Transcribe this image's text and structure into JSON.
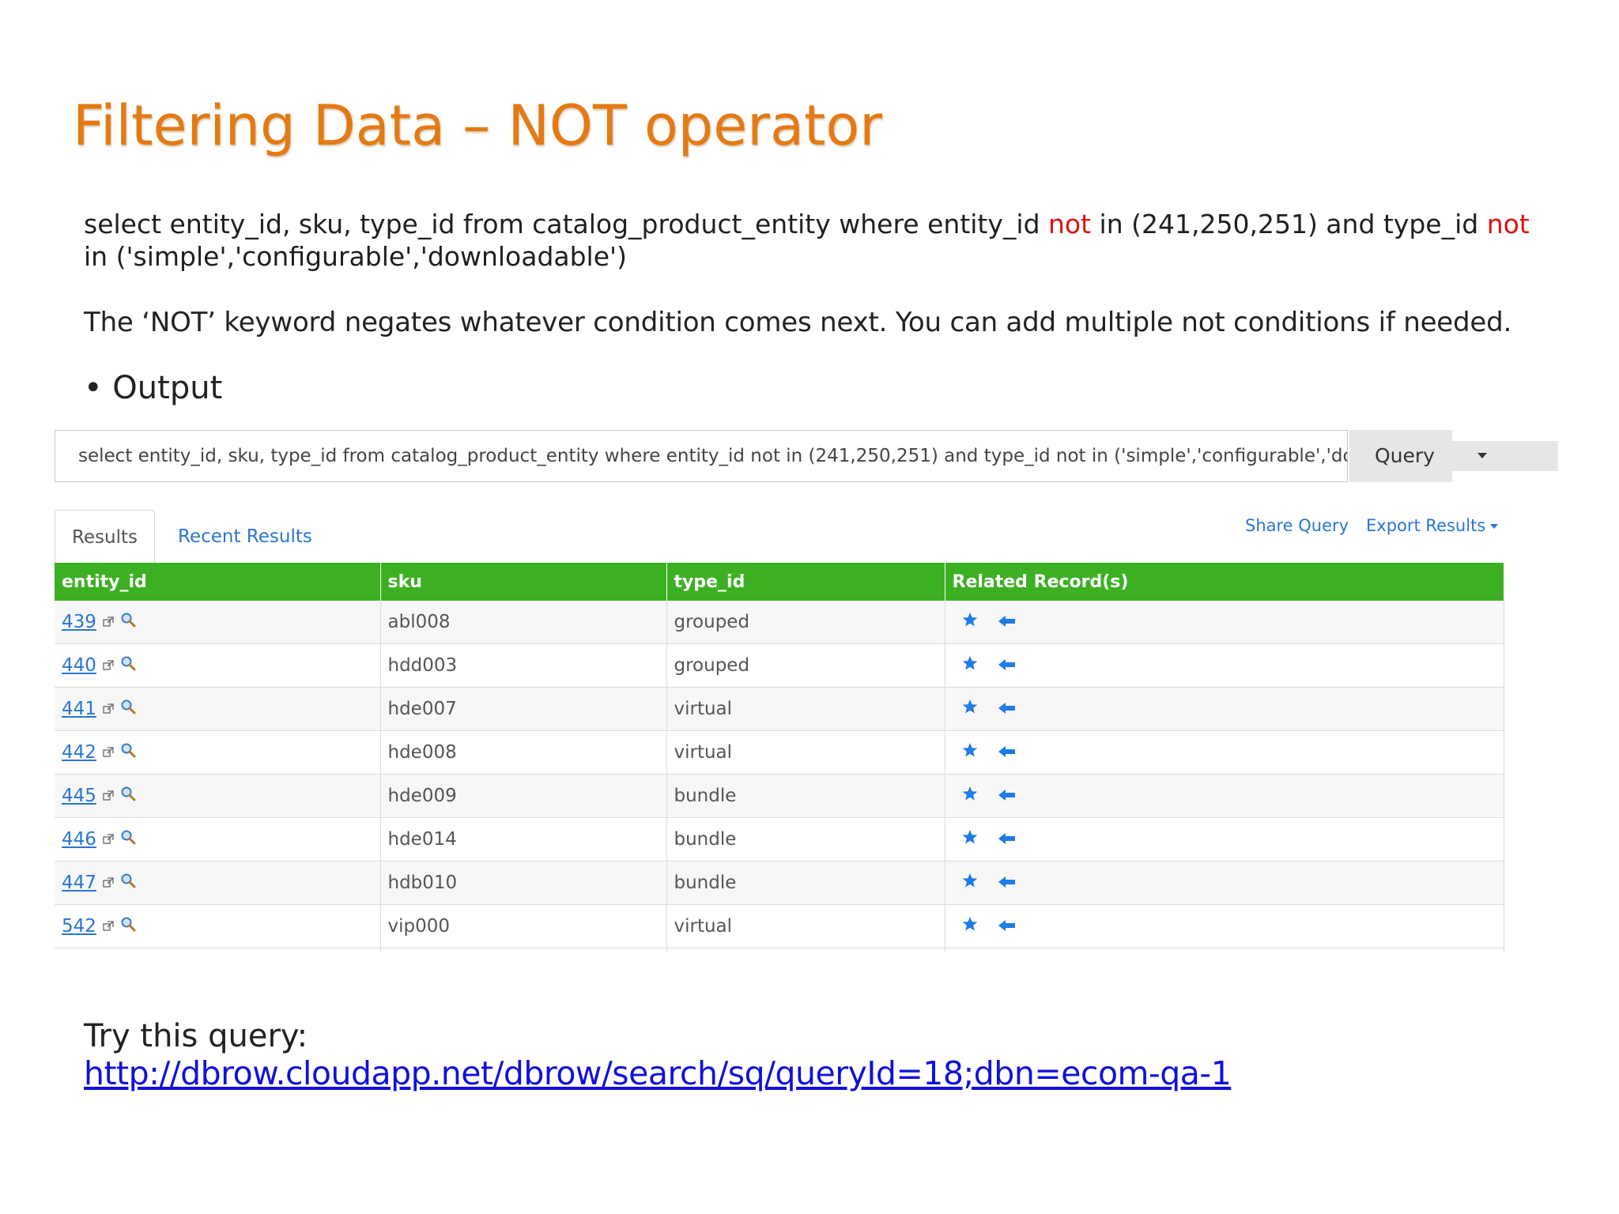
{
  "slide": {
    "title": "Filtering Data – NOT operator",
    "sql": {
      "part1": "select entity_id, sku, type_id from catalog_product_entity where entity_id ",
      "not1": "not",
      "part2": " in (241,250,251) and type_id ",
      "not2": "not",
      "line2": "in ('simple','configurable','downloadable')"
    },
    "description": "The ‘NOT’ keyword negates whatever condition comes next. You can add multiple not conditions if needed.",
    "bullet": "• Output",
    "try_label": "Try this query:",
    "try_link": "http://dbrow.cloudapp.net/dbrow/search/sq/queryId=18;dbn=ecom-qa-1"
  },
  "query_bar": {
    "value": "select entity_id, sku, type_id from catalog_product_entity where entity_id not in (241,250,251) and type_id not in ('simple','configurable','downloadable')",
    "button_label": "Query"
  },
  "tabs": [
    {
      "label": "Results",
      "active": true
    },
    {
      "label": "Recent Results",
      "active": false
    }
  ],
  "actions": {
    "share": "Share Query",
    "export": "Export Results"
  },
  "table": {
    "columns": [
      "entity_id",
      "sku",
      "type_id",
      "Related Record(s)"
    ],
    "rows": [
      {
        "entity_id": "439",
        "sku": "abl008",
        "type_id": "grouped"
      },
      {
        "entity_id": "440",
        "sku": "hdd003",
        "type_id": "grouped"
      },
      {
        "entity_id": "441",
        "sku": "hde007",
        "type_id": "virtual"
      },
      {
        "entity_id": "442",
        "sku": "hde008",
        "type_id": "virtual"
      },
      {
        "entity_id": "445",
        "sku": "hde009",
        "type_id": "bundle"
      },
      {
        "entity_id": "446",
        "sku": "hde014",
        "type_id": "bundle"
      },
      {
        "entity_id": "447",
        "sku": "hdb010",
        "type_id": "bundle"
      },
      {
        "entity_id": "542",
        "sku": "vip000",
        "type_id": "virtual"
      }
    ],
    "row_icons": [
      "external-link-icon",
      "magnifier-icon",
      "star-icon",
      "arrow-left-icon"
    ]
  },
  "colors": {
    "title": "#e47a14",
    "not_keyword": "#dd1111",
    "table_header": "#3cb022",
    "link": "#2a76d2",
    "footer_link": "#1010dd"
  }
}
